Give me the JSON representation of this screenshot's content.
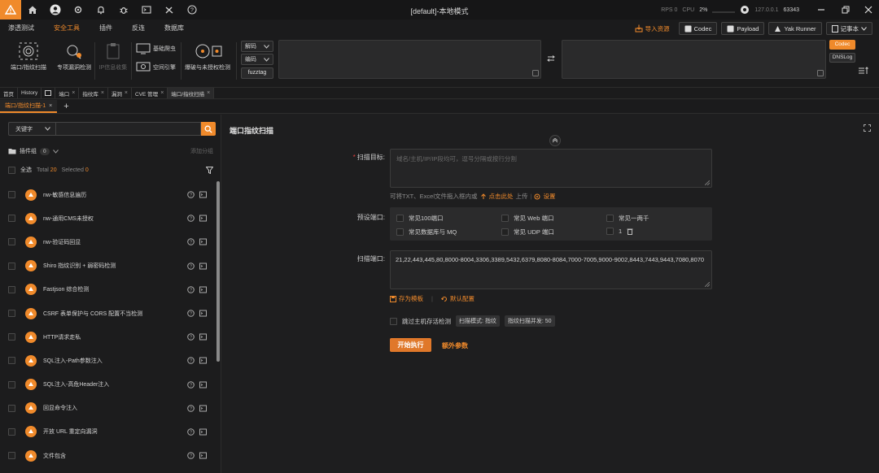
{
  "window": {
    "title": "[default]-本地模式"
  },
  "sysinfo": {
    "rps": "RPS 0",
    "cpu_label": "CPU",
    "cpu_value": "2%",
    "host": "127.0.0.1",
    "port": "63343"
  },
  "menu": {
    "items": [
      "渗透测试",
      "安全工具",
      "插件",
      "反连",
      "数据库"
    ],
    "import_label": "导入资源",
    "codec_label": "Codec",
    "payload_label": "Payload",
    "yakrunner_label": "Yak Runner",
    "notebook_label": "记事本"
  },
  "toolbar": {
    "port_scan": "端口/指纹扫描",
    "vuln_check": "专项漏洞检测",
    "hash_crack": "IP信息收集",
    "crawler": "基础爬虫",
    "space_engine": "空间引擎",
    "brute": "爆破与未授权检测",
    "decode_label": "解码",
    "encode_label": "编码",
    "fuzztag_label": "fuzztag",
    "codec_btn": "Codec",
    "dnslog_btn": "DNSLog"
  },
  "tabs": [
    "首页",
    "History",
    "端口",
    "指纹库",
    "漏洞",
    "CVE 管理",
    "端口/指纹扫描"
  ],
  "subtab": {
    "label": "端口/指纹扫描-1"
  },
  "left": {
    "keyword_select": "关键字",
    "search_placeholder": "",
    "group_label": "插件组",
    "group_count": "0",
    "add_group": "添加分组",
    "select_all": "全选",
    "total_label": "Total",
    "total_value": "20",
    "selected_label": "Selected",
    "selected_value": "0",
    "plugins": [
      "nw-敏感信息遍历",
      "nw-通用CMS未授权",
      "nw-验证码回显",
      "Shiro 指纹识别 + 弱密码检测",
      "Fastjson 综合检测",
      "CSRF 表单保护与 CORS 配置不当检测",
      "HTTP请求走私",
      "SQL注入-Path参数注入",
      "SQL注入-高危Header注入",
      "回显命令注入",
      "开放 URL 重定向漏洞",
      "文件包含"
    ]
  },
  "form": {
    "title": "端口指纹扫描",
    "target_label": "扫描目标:",
    "target_placeholder": "域名/主机/IP/IP段均可，逗号分隔或按行分割",
    "hint_text": "可将TXT、Excel文件拖入框内或",
    "hint_click": "点击此处",
    "hint_upload": "上传",
    "hint_settings": "设置",
    "preset_label": "预设端口:",
    "presets": [
      "常见100端口",
      "常见 Web 端口",
      "常见一两千",
      "常见数据库与 MQ",
      "常见 UDP 端口",
      "1"
    ],
    "ports_label": "扫描端口:",
    "ports_value": "21,22,443,445,80,8000-8004,3306,3389,5432,6379,8080-8084,7000-7005,9000-9002,8443,7443,9443,7080,8070",
    "save_template": "存为模板",
    "default_config": "默认配置",
    "skip_alive": "跳过主机存活检测",
    "scan_mode": "扫描模式: 指纹",
    "concurrency": "指纹扫描并发: 50",
    "run_btn": "开始执行",
    "extra_btn": "额外参数"
  },
  "colors": {
    "accent": "#f08a2b",
    "bg": "#1e1e1f"
  }
}
